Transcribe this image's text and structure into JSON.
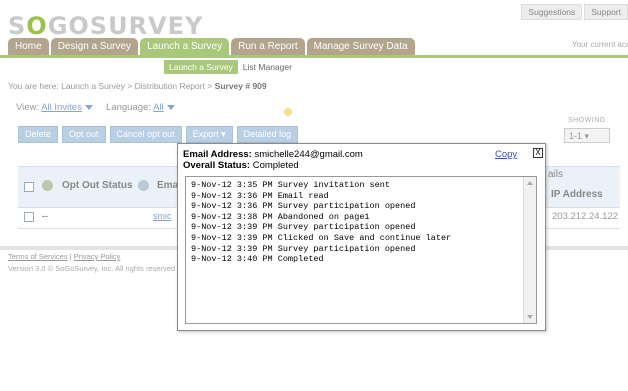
{
  "header": {
    "logo_prefix": "S",
    "logo_o": "O",
    "logo_suffix": "GOSURVEY",
    "links": [
      "Suggestions",
      "Support"
    ],
    "current_account": "Your current acc"
  },
  "nav": {
    "tabs": [
      "Home",
      "Design a Survey",
      "Launch a Survey",
      "Run a Report",
      "Manage Survey Data"
    ],
    "active": "Launch a Survey",
    "sub": [
      "Launch a Survey",
      "List Manager"
    ]
  },
  "breadcrumb": {
    "prefix": "You are here: Launch a Survey > Distribution Report > ",
    "current": "Survey # 909"
  },
  "view": {
    "view_label": "View:",
    "view_value": "All Invites",
    "lang_label": "Language:",
    "lang_value": "All"
  },
  "showing": {
    "label": "SHOWING",
    "value": "1-1"
  },
  "buttons": [
    "Delete",
    "Opt out",
    "Cancel opt out",
    "Export",
    "Detailed log"
  ],
  "table": {
    "col_opt_out": "Opt Out Status",
    "col_email": "Email",
    "col_details": "ails",
    "col_ip": "IP Address",
    "row": {
      "opt_out": "--",
      "email": "smic",
      "ip": "203.212.24.122"
    }
  },
  "footer": {
    "terms": "Terms of Services",
    "sep": "|",
    "privacy": "Privacy Policy",
    "version": "Version 3.0 © SoGoSurvey, Inc. All rights reserved"
  },
  "modal": {
    "email_label": "Email Address:",
    "email_value": "smichelle244@gmail.com",
    "status_label": "Overall Status:",
    "status_value": "Completed",
    "copy_label": "Copy",
    "close_label": "X",
    "log": [
      "9-Nov-12 3:35 PM Survey invitation sent",
      "9-Nov-12 3:36 PM Email read",
      "9-Nov-12 3:36 PM Survey participation opened",
      "9-Nov-12 3:38 PM Abandoned on page1",
      "9-Nov-12 3:39 PM Survey participation opened",
      "9-Nov-12 3:39 PM Clicked on Save and continue later",
      "9-Nov-12 3:39 PM Survey participation opened",
      "9-Nov-12 3:40 PM Completed"
    ]
  }
}
